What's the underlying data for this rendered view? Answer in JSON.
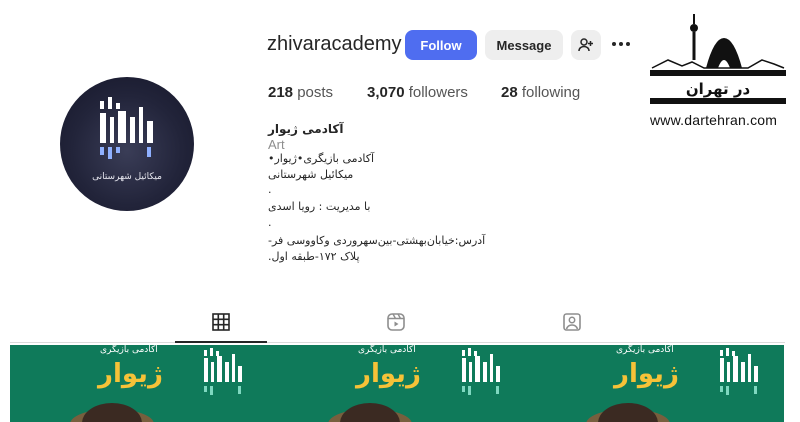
{
  "profile": {
    "username": "zhivaracademy",
    "follow_label": "Follow",
    "message_label": "Message",
    "posts_count": "218",
    "posts_label": "posts",
    "followers_count": "3,070",
    "followers_label": "followers",
    "following_count": "28",
    "following_label": "following",
    "display_name": "آکادمی ژیوار",
    "category": "Art",
    "bio_lines": [
      "آکادمی بازیگری•ژیوار•",
      "میکائیل شهرستانی",
      ".",
      "با مدیریت : رویا اسدی",
      ".",
      "آدرس:خیابان‌بهشتی-بین‌سهروردی وکاووسی فر-",
      "پلاک ۱۷۲-طبقه اول."
    ],
    "avatar_caption": "میکائیل شهرستانی"
  },
  "icons": {
    "add_user": "person-add-icon",
    "more": "more-horizontal-icon",
    "grid_tab": "grid-icon",
    "reels_tab": "reels-icon",
    "tagged_tab": "tagged-icon"
  },
  "watermark": {
    "brand_fa": "در تهران",
    "url": "www.dartehran.com"
  },
  "posts": [
    {
      "subtitle": "آکادمی بازیگری",
      "title": "ژیوار"
    },
    {
      "subtitle": "آکادمی بازیگری",
      "title": "ژیوار"
    },
    {
      "subtitle": "آکادمی بازیگری",
      "title": "ژیوار"
    }
  ],
  "colors": {
    "follow_button": "#4f6df0",
    "post_background": "#0f7a5a",
    "post_title": "#f6c238"
  }
}
